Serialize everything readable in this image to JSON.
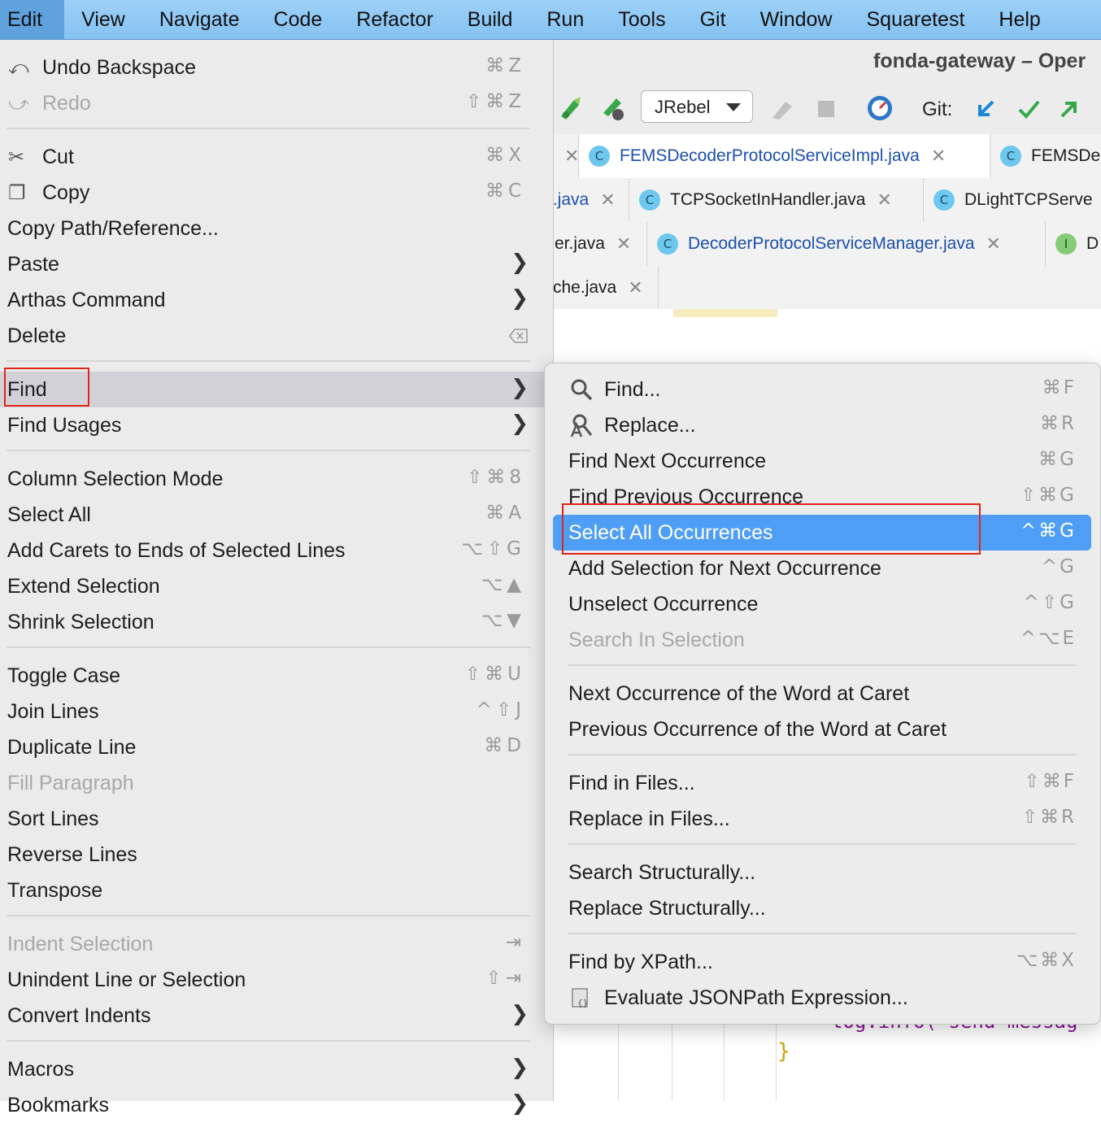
{
  "menubar": {
    "items": [
      "Edit",
      "View",
      "Navigate",
      "Code",
      "Refactor",
      "Build",
      "Run",
      "Tools",
      "Git",
      "Window",
      "Squaretest",
      "Help"
    ]
  },
  "ide": {
    "window_title": "fonda-gateway – Oper",
    "run_config": "JRebel",
    "git_label": "Git:",
    "tab_rows": [
      [
        {
          "name": "FEMSDecoderProtocolServiceImpl.java",
          "kind": "C",
          "blue": true
        },
        {
          "name": "FEMSDe",
          "kind": "C",
          "blue": false
        }
      ],
      [
        {
          "name": "r.java",
          "kind": "",
          "blue": true
        },
        {
          "name": "TCPSocketInHandler.java",
          "kind": "C",
          "blue": false
        },
        {
          "name": "DLightTCPServe",
          "kind": "C",
          "blue": false
        }
      ],
      [
        {
          "name": "er.java",
          "kind": "",
          "blue": false
        },
        {
          "name": "DecoderProtocolServiceManager.java",
          "kind": "C",
          "blue": true
        },
        {
          "name": "D",
          "kind": "I",
          "blue": false
        }
      ],
      [
        {
          "name": "che.java",
          "kind": "",
          "blue": false
        }
      ]
    ]
  },
  "edit_menu": {
    "items": [
      {
        "label": "Undo Backspace",
        "shortcut": "⌘Z",
        "icon": "undo-icon"
      },
      {
        "label": "Redo",
        "shortcut": "⇧⌘Z",
        "icon": "redo-icon",
        "disabled": true
      },
      {
        "label": "Cut",
        "shortcut": "⌘X",
        "icon": "scissors-icon"
      },
      {
        "label": "Copy",
        "shortcut": "⌘C",
        "icon": "copy-icon"
      },
      {
        "label": "Copy Path/Reference..."
      },
      {
        "label": "Paste",
        "submenu": true
      },
      {
        "label": "Arthas Command",
        "submenu": true
      },
      {
        "label": "Delete",
        "icon_right": "delete-key-icon"
      },
      {
        "label": "Find",
        "submenu": true,
        "hover": true
      },
      {
        "label": "Find Usages",
        "submenu": true
      },
      {
        "label": "Column Selection Mode",
        "shortcut": "⇧⌘8"
      },
      {
        "label": "Select All",
        "shortcut": "⌘A"
      },
      {
        "label": "Add Carets to Ends of Selected Lines",
        "shortcut": "⌥⇧G"
      },
      {
        "label": "Extend Selection",
        "shortcut": "⌥▲"
      },
      {
        "label": "Shrink Selection",
        "shortcut": "⌥▼"
      },
      {
        "label": "Toggle Case",
        "shortcut": "⇧⌘U"
      },
      {
        "label": "Join Lines",
        "shortcut": "^⇧J"
      },
      {
        "label": "Duplicate Line",
        "shortcut": "⌘D"
      },
      {
        "label": "Fill Paragraph",
        "disabled": true
      },
      {
        "label": "Sort Lines"
      },
      {
        "label": "Reverse Lines"
      },
      {
        "label": "Transpose"
      },
      {
        "label": "Indent Selection",
        "shortcut": "⇥",
        "disabled": true
      },
      {
        "label": "Unindent Line or Selection",
        "shortcut": "⇧⇥"
      },
      {
        "label": "Convert Indents",
        "submenu": true
      },
      {
        "label": "Macros",
        "submenu": true
      },
      {
        "label": "Bookmarks",
        "submenu": true
      }
    ]
  },
  "find_menu": {
    "items": [
      {
        "label": "Find...",
        "shortcut": "⌘F",
        "icon": "search-icon"
      },
      {
        "label": "Replace...",
        "shortcut": "⌘R",
        "icon": "replace-icon"
      },
      {
        "label": "Find Next Occurrence",
        "shortcut": "⌘G"
      },
      {
        "label": "Find Previous Occurrence",
        "shortcut": "⇧⌘G"
      },
      {
        "label": "Select All Occurrences",
        "shortcut": "^⌘G",
        "selected": true
      },
      {
        "label": "Add Selection for Next Occurrence",
        "shortcut": "^G"
      },
      {
        "label": "Unselect Occurrence",
        "shortcut": "^⇧G"
      },
      {
        "label": "Search In Selection",
        "shortcut": "^⌥E",
        "disabled": true
      },
      {
        "label": "Next Occurrence of the Word at Caret"
      },
      {
        "label": "Previous Occurrence of the Word at Caret"
      },
      {
        "label": "Find in Files...",
        "shortcut": "⇧⌘F"
      },
      {
        "label": "Replace in Files...",
        "shortcut": "⇧⌘R"
      },
      {
        "label": "Search Structurally..."
      },
      {
        "label": "Replace Structurally..."
      },
      {
        "label": "Find by XPath...",
        "shortcut": "⌥⌘X"
      },
      {
        "label": "Evaluate JSONPath Expression...",
        "icon": "jsonpath-icon"
      }
    ]
  },
  "code_fragment": "log.info(\"send messag"
}
